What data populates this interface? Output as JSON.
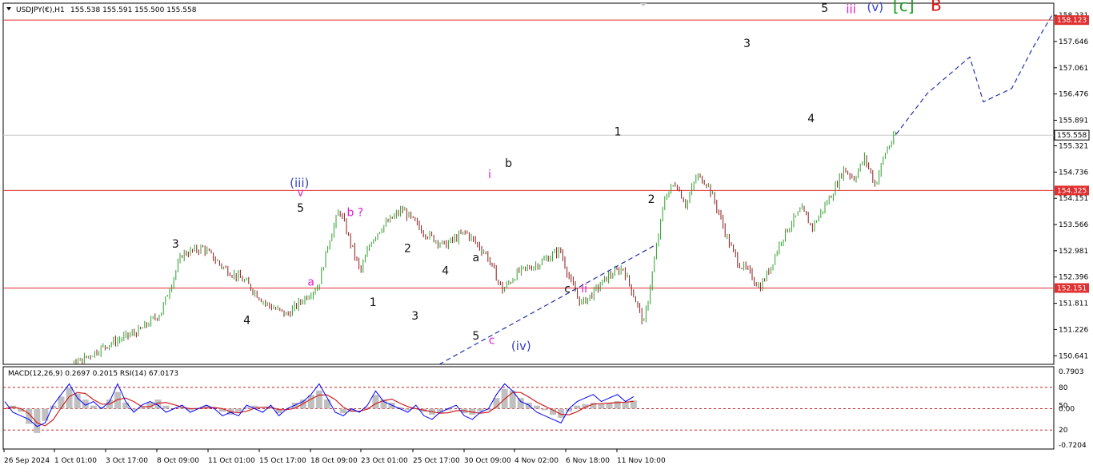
{
  "header": {
    "symbol_label": "USDJPY(€),H1",
    "quote": "155.538 155.591 155.500 155.558"
  },
  "colors": {
    "bull": "#2ca02c",
    "bear": "#8b1a1a",
    "hline": "#e03030",
    "price_line": "#c8c8c8",
    "trend": "#2233aa",
    "black": "#111111",
    "magenta": "#e020d0",
    "blue": "#3340c8",
    "green": "#1a9a1a",
    "red": "#e01010",
    "macd_hist": "#c0c0c0",
    "rsi": "#0000ff",
    "signal": "#d02020",
    "level": "#d02020"
  },
  "chart_data": [
    {
      "type": "candlestick",
      "title": "USDJPY(€),H1",
      "ylim": [
        150.45,
        158.5
      ],
      "price_ticks": [
        "158.231",
        "157.646",
        "157.061",
        "156.476",
        "155.891",
        "155.321",
        "154.736",
        "154.151",
        "153.566",
        "152.981",
        "152.396",
        "151.811",
        "151.226",
        "150.641"
      ],
      "horizontal_levels": [
        {
          "value": 158.123,
          "label": "158.123"
        },
        {
          "value": 154.325,
          "label": "154.325"
        },
        {
          "value": 152.151,
          "label": "152.151"
        }
      ],
      "current_price": {
        "value": 155.558,
        "label": "155.558"
      },
      "time_labels": [
        "26 Sep 2024",
        "1 Oct 01:00",
        "3 Oct 17:00",
        "8 Oct 09:00",
        "11 Oct 01:00",
        "15 Oct 17:00",
        "18 Oct 09:00",
        "23 Oct 01:00",
        "25 Oct 17:00",
        "30 Oct 09:00",
        "4 Nov 02:00",
        "6 Nov 18:00",
        "11 Nov 10:00"
      ],
      "price_path": [
        [
          0,
          150.0
        ],
        [
          0.05,
          150.2
        ],
        [
          0.1,
          150.9
        ],
        [
          0.13,
          151.2
        ],
        [
          0.15,
          151.6
        ],
        [
          0.17,
          152.9
        ],
        [
          0.19,
          153.05
        ],
        [
          0.21,
          152.6
        ],
        [
          0.23,
          152.3
        ],
        [
          0.25,
          151.8
        ],
        [
          0.27,
          151.55
        ],
        [
          0.29,
          152.0
        ],
        [
          0.3,
          152.2
        ],
        [
          0.31,
          153.2
        ],
        [
          0.32,
          153.9
        ],
        [
          0.33,
          153.2
        ],
        [
          0.34,
          152.5
        ],
        [
          0.35,
          153.2
        ],
        [
          0.36,
          153.5
        ],
        [
          0.38,
          153.9
        ],
        [
          0.4,
          153.4
        ],
        [
          0.42,
          153.1
        ],
        [
          0.44,
          153.4
        ],
        [
          0.46,
          152.9
        ],
        [
          0.475,
          152.1
        ],
        [
          0.49,
          152.5
        ],
        [
          0.51,
          152.7
        ],
        [
          0.53,
          153.0
        ],
        [
          0.54,
          152.3
        ],
        [
          0.55,
          151.8
        ],
        [
          0.56,
          152.0
        ],
        [
          0.575,
          152.4
        ],
        [
          0.59,
          152.6
        ],
        [
          0.6,
          152.0
        ],
        [
          0.61,
          151.35
        ],
        [
          0.62,
          152.8
        ],
        [
          0.63,
          154.2
        ],
        [
          0.64,
          154.5
        ],
        [
          0.65,
          154.0
        ],
        [
          0.66,
          154.65
        ],
        [
          0.67,
          154.5
        ],
        [
          0.68,
          153.9
        ],
        [
          0.69,
          153.2
        ],
        [
          0.7,
          152.7
        ],
        [
          0.71,
          152.5
        ],
        [
          0.72,
          152.15
        ],
        [
          0.73,
          152.6
        ],
        [
          0.74,
          153.2
        ],
        [
          0.75,
          153.6
        ],
        [
          0.76,
          153.9
        ],
        [
          0.77,
          153.5
        ],
        [
          0.78,
          153.9
        ],
        [
          0.79,
          154.3
        ],
        [
          0.8,
          154.8
        ],
        [
          0.81,
          154.6
        ],
        [
          0.82,
          155.05
        ],
        [
          0.83,
          154.45
        ],
        [
          0.84,
          155.2
        ],
        [
          0.85,
          155.58
        ]
      ],
      "wave_labels": [
        {
          "text": "3",
          "x": 0.164,
          "y": 153.05,
          "color": "black"
        },
        {
          "text": "4",
          "x": 0.232,
          "y": 151.35,
          "color": "black"
        },
        {
          "text": "(iii)",
          "x": 0.282,
          "y": 154.4,
          "color": "blue"
        },
        {
          "text": "v",
          "x": 0.283,
          "y": 154.2,
          "color": "magenta"
        },
        {
          "text": "5",
          "x": 0.283,
          "y": 153.85,
          "color": "black"
        },
        {
          "text": "a",
          "x": 0.293,
          "y": 152.2,
          "color": "magenta"
        },
        {
          "text": "b ?",
          "x": 0.335,
          "y": 153.75,
          "color": "magenta"
        },
        {
          "text": "1",
          "x": 0.352,
          "y": 151.75,
          "color": "black"
        },
        {
          "text": "2",
          "x": 0.385,
          "y": 152.95,
          "color": "black"
        },
        {
          "text": "3",
          "x": 0.392,
          "y": 151.45,
          "color": "black"
        },
        {
          "text": "4",
          "x": 0.421,
          "y": 152.45,
          "color": "black"
        },
        {
          "text": "a",
          "x": 0.45,
          "y": 152.75,
          "color": "black"
        },
        {
          "text": "5",
          "x": 0.45,
          "y": 151.0,
          "color": "black"
        },
        {
          "text": "c",
          "x": 0.465,
          "y": 150.9,
          "color": "magenta"
        },
        {
          "text": "(iv)",
          "x": 0.493,
          "y": 150.77,
          "color": "blue"
        },
        {
          "text": "i",
          "x": 0.463,
          "y": 154.6,
          "color": "magenta"
        },
        {
          "text": "b",
          "x": 0.481,
          "y": 154.85,
          "color": "black"
        },
        {
          "text": "c",
          "x": 0.537,
          "y": 152.05,
          "color": "black"
        },
        {
          "text": "ii",
          "x": 0.553,
          "y": 152.05,
          "color": "magenta"
        },
        {
          "text": "1",
          "x": 0.585,
          "y": 155.55,
          "color": "black"
        },
        {
          "text": "2",
          "x": 0.617,
          "y": 154.05,
          "color": "black"
        },
        {
          "text": "3",
          "x": 0.708,
          "y": 157.52,
          "color": "black"
        },
        {
          "text": "4",
          "x": 0.769,
          "y": 155.85,
          "color": "black"
        },
        {
          "text": "5",
          "x": 0.782,
          "y": 158.3,
          "color": "black"
        },
        {
          "text": "iii",
          "x": 0.807,
          "y": 158.28,
          "color": "magenta"
        },
        {
          "text": "(v)",
          "x": 0.83,
          "y": 158.32,
          "color": "blue"
        },
        {
          "text": "[c]",
          "x": 0.857,
          "y": 158.32,
          "color": "green"
        },
        {
          "text": "B",
          "x": 0.888,
          "y": 158.33,
          "color": "red"
        }
      ],
      "projection_path": [
        [
          0.85,
          155.58
        ],
        [
          0.88,
          156.5
        ],
        [
          0.92,
          157.3
        ],
        [
          0.933,
          156.3
        ],
        [
          0.96,
          156.6
        ],
        [
          0.98,
          157.5
        ],
        [
          1.0,
          158.3
        ]
      ],
      "trend_channel": [
        [
          0.415,
          150.45
        ],
        [
          0.62,
          153.1
        ]
      ]
    },
    {
      "type": "line",
      "title": "MACD(12,26,9) 0.2697 0.2015 RSI(14) 67.0173",
      "scale_labels_left": [
        "0.7903",
        "0.00",
        "-0.7204"
      ],
      "scale_labels_right": [
        "80",
        "50",
        "20"
      ],
      "levels": [
        80,
        50,
        20
      ],
      "series": [
        {
          "name": "MACD(12,26,9)",
          "values": [
            0.0,
            0.1,
            -0.1,
            -0.5,
            -0.8,
            -0.4,
            0.1,
            0.4,
            0.7,
            0.5,
            0.3,
            0.1,
            0.05,
            0.3,
            0.55,
            0.2,
            -0.05,
            0.05,
            0.2,
            0.3,
            0.1,
            0.0,
            0.05,
            -0.05,
            0.02,
            0.1,
            0.0,
            -0.1,
            -0.2,
            -0.1,
            0.05,
            0.1,
            0.0,
            0.05,
            -0.15,
            0.0,
            0.2,
            0.3,
            0.45,
            0.6,
            0.3,
            0.0,
            -0.15,
            -0.1,
            0.0,
            0.05,
            0.45,
            0.3,
            0.2,
            0.05,
            -0.05,
            0.0,
            -0.1,
            -0.2,
            -0.15,
            -0.05,
            0.0,
            -0.15,
            -0.2,
            -0.1,
            -0.05,
            0.35,
            0.65,
            0.6,
            0.35,
            0.2,
            0.1,
            -0.05,
            -0.2,
            -0.3,
            -0.1,
            0.1,
            0.15,
            0.2,
            0.15,
            0.2,
            0.25,
            0.2,
            0.27
          ]
        },
        {
          "name": "RSI(14)",
          "values": [
            60,
            45,
            40,
            35,
            25,
            30,
            55,
            70,
            85,
            65,
            55,
            60,
            50,
            60,
            85,
            60,
            45,
            55,
            60,
            55,
            45,
            50,
            55,
            45,
            50,
            55,
            50,
            40,
            45,
            40,
            55,
            50,
            45,
            55,
            40,
            50,
            55,
            60,
            70,
            85,
            65,
            45,
            40,
            50,
            45,
            55,
            75,
            60,
            55,
            50,
            45,
            55,
            40,
            35,
            45,
            50,
            55,
            40,
            35,
            45,
            50,
            70,
            85,
            75,
            60,
            55,
            45,
            40,
            35,
            30,
            50,
            60,
            65,
            70,
            60,
            65,
            70,
            60,
            67
          ]
        }
      ]
    }
  ]
}
